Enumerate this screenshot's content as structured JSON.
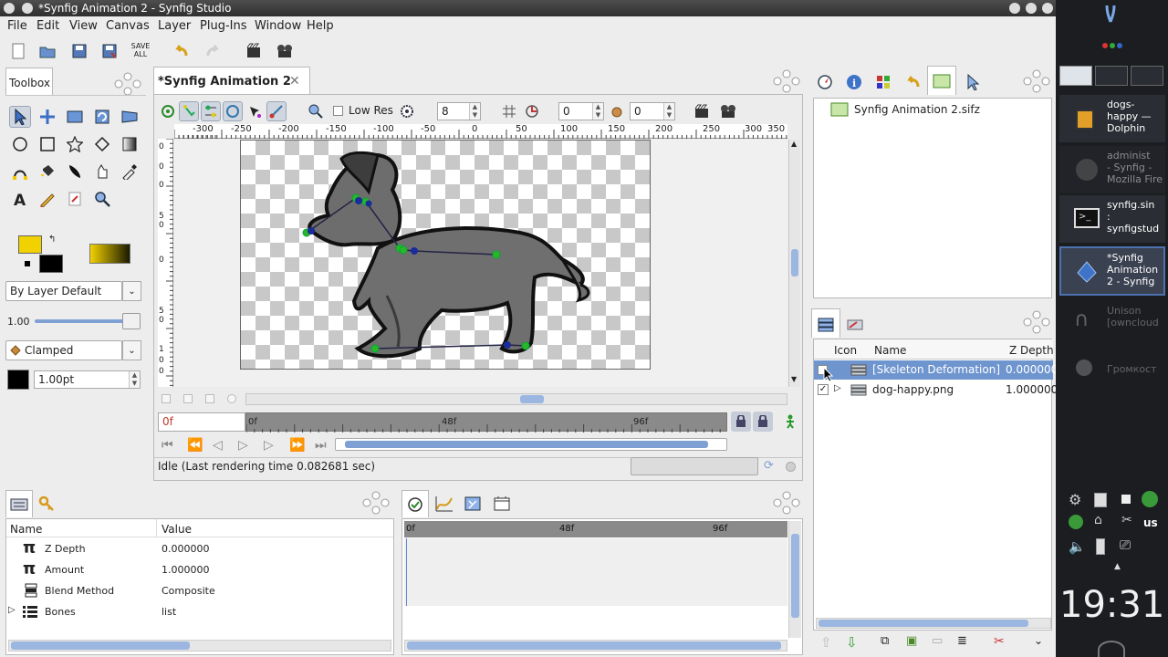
{
  "window": {
    "title": "*Synfig Animation 2 - Synfig Studio"
  },
  "menu": [
    "File",
    "Edit",
    "View",
    "Canvas",
    "Layer",
    "Plug-Ins",
    "Window",
    "Help"
  ],
  "toolbar": {
    "save_all_line1": "SAVE",
    "save_all_line2": "ALL"
  },
  "toolbox": {
    "tab": "Toolbox",
    "blend_method": "By Layer Default",
    "opacity_value": "1.00",
    "interpolation": "Clamped",
    "brush_size": "1.00pt"
  },
  "canvas": {
    "tab": "*Synfig Animation 2",
    "low_res_label": "Low Res",
    "quality_value": "8",
    "onion_past": "0",
    "onion_future": "0",
    "ruler_h": [
      "-300",
      "-250",
      "-200",
      "-150",
      "-100",
      "-50",
      "0",
      "50",
      "100",
      "150",
      "200",
      "250",
      "300",
      "350"
    ],
    "ruler_v": [
      "0",
      "0",
      "0",
      "5",
      "0",
      "0",
      "5",
      "0",
      "1",
      "0",
      "0"
    ],
    "current_time": "0f",
    "time_marks": [
      "0f",
      "48f",
      "96f"
    ],
    "status": "Idle (Last rendering time 0.082681 sec)"
  },
  "canvas_browser": {
    "item": "Synfig Animation 2.sifz"
  },
  "layers": {
    "columns": [
      "Icon",
      "Name",
      "Z Depth"
    ],
    "rows": [
      {
        "name": "[Skeleton Deformation]",
        "zdepth": "0.000000",
        "checked": false
      },
      {
        "name": "dog-happy.png",
        "zdepth": "1.000000",
        "checked": true
      }
    ]
  },
  "params": {
    "columns": [
      "Name",
      "Value"
    ],
    "rows": [
      {
        "name": "Z Depth",
        "value": "0.000000"
      },
      {
        "name": "Amount",
        "value": "1.000000"
      },
      {
        "name": "Blend Method",
        "value": "Composite"
      },
      {
        "name": "Bones",
        "value": "list"
      }
    ]
  },
  "timetrack": {
    "marks": [
      "0f",
      "48f",
      "96f"
    ]
  },
  "taskbar": {
    "items": [
      {
        "line1": "dogs-",
        "line2": "happy —",
        "line3": "Dolphin"
      },
      {
        "line1": "administ",
        "line2": "- Synfig -",
        "line3": "Mozilla Fire"
      },
      {
        "line1": "synfig.sin",
        "line2": ":",
        "line3": "synfigstud"
      },
      {
        "line1": "*Synfig",
        "line2": "Animation",
        "line3": "2 - Synfig"
      },
      {
        "line1": "Unison",
        "line2": "[owncloud",
        "line3": ""
      },
      {
        "line1": "Громкост",
        "line2": "",
        "line3": ""
      }
    ],
    "lang": "us",
    "clock": "19:31"
  },
  "colors": {
    "fill_color": "#f2d100",
    "outline_color": "#000000",
    "selection_blue": "#7f9fd6",
    "accent_blue": "#6f95cf"
  }
}
